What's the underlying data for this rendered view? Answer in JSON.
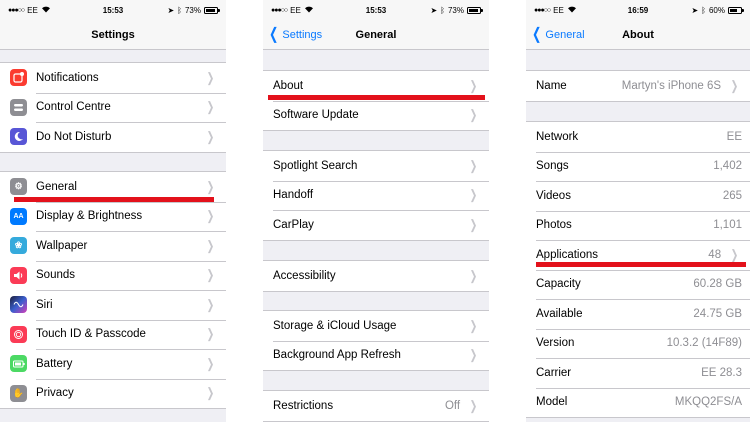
{
  "colors": {
    "accent": "#0a7aff",
    "highlight": "#e3111b"
  },
  "screens": [
    {
      "status": {
        "carrier": "EE",
        "time": "15:53",
        "battery": "73%",
        "battery_level": 0.73
      },
      "nav": {
        "title": "Settings",
        "back": ""
      },
      "groups": [
        [
          {
            "label": "Notifications",
            "icon": "notifications-icon",
            "color": "#fb3b30"
          },
          {
            "label": "Control Centre",
            "icon": "control-centre-icon",
            "color": "#8e8e93"
          },
          {
            "label": "Do Not Disturb",
            "icon": "moon-icon",
            "color": "#5856d6"
          }
        ],
        [
          {
            "label": "General",
            "icon": "gear-icon",
            "color": "#8e8e93"
          },
          {
            "label": "Display & Brightness",
            "icon": "display-brightness-icon",
            "color": "#007aff"
          },
          {
            "label": "Wallpaper",
            "icon": "wallpaper-icon",
            "color": "#35aadc"
          },
          {
            "label": "Sounds",
            "icon": "speaker-icon",
            "color": "#fb3b56"
          },
          {
            "label": "Siri",
            "icon": "siri-icon",
            "color": "#1c1c3a"
          },
          {
            "label": "Touch ID & Passcode",
            "icon": "fingerprint-icon",
            "color": "#fb3b56"
          },
          {
            "label": "Battery",
            "icon": "battery-icon",
            "color": "#4cd964"
          },
          {
            "label": "Privacy",
            "icon": "hand-icon",
            "color": "#8e8e93"
          }
        ]
      ]
    },
    {
      "status": {
        "carrier": "EE",
        "time": "15:53",
        "battery": "73%",
        "battery_level": 0.73
      },
      "nav": {
        "title": "General",
        "back": "Settings"
      },
      "groups": [
        [
          {
            "label": "About",
            "value": ""
          },
          {
            "label": "Software Update",
            "value": ""
          }
        ],
        [
          {
            "label": "Spotlight Search",
            "value": ""
          },
          {
            "label": "Handoff",
            "value": ""
          },
          {
            "label": "CarPlay",
            "value": ""
          }
        ],
        [
          {
            "label": "Accessibility",
            "value": ""
          }
        ],
        [
          {
            "label": "Storage & iCloud Usage",
            "value": ""
          },
          {
            "label": "Background App Refresh",
            "value": ""
          }
        ],
        [
          {
            "label": "Restrictions",
            "value": "Off"
          }
        ]
      ]
    },
    {
      "status": {
        "carrier": "EE",
        "time": "16:59",
        "battery": "60%",
        "battery_level": 0.6
      },
      "nav": {
        "title": "About",
        "back": "General"
      },
      "groups": [
        [
          {
            "label": "Name",
            "value": "Martyn's iPhone 6S",
            "chevron": true
          }
        ],
        [
          {
            "label": "Network",
            "value": "EE",
            "chevron": false
          },
          {
            "label": "Songs",
            "value": "1,402",
            "chevron": false
          },
          {
            "label": "Videos",
            "value": "265",
            "chevron": false
          },
          {
            "label": "Photos",
            "value": "1,101",
            "chevron": false
          },
          {
            "label": "Applications",
            "value": "48",
            "chevron": true
          },
          {
            "label": "Capacity",
            "value": "60.28 GB",
            "chevron": false
          },
          {
            "label": "Available",
            "value": "24.75 GB",
            "chevron": false
          },
          {
            "label": "Version",
            "value": "10.3.2 (14F89)",
            "chevron": false
          },
          {
            "label": "Carrier",
            "value": "EE 28.3",
            "chevron": false
          },
          {
            "label": "Model",
            "value": "MKQQ2FS/A",
            "chevron": false
          }
        ]
      ]
    }
  ]
}
